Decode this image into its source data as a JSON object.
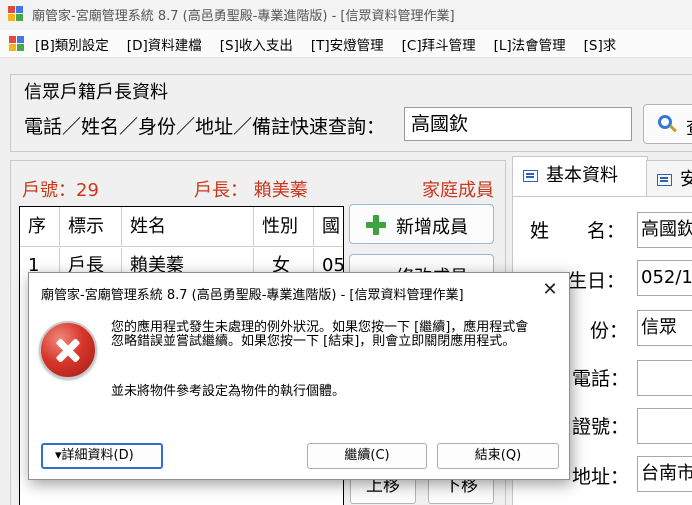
{
  "window": {
    "title": "廟管家-宮廟管理系統 8.7 (高邑勇聖殿-專業進階版) - [信眾資料管理作業]"
  },
  "menu": {
    "items": [
      "[B]類別設定",
      "[D]資料建檔",
      "[S]收入支出",
      "[T]安燈管理",
      "[C]拜斗管理",
      "[L]法會管理",
      "[S]求"
    ]
  },
  "search": {
    "title": "信眾戶籍戶長資料",
    "label": "電話／姓名／身份／地址／備註快速查詢：",
    "value": "高國欽",
    "button_label": "查"
  },
  "household": {
    "number": "戶號：29",
    "head": "戶長： 賴美蓁",
    "members_title": "家庭成員"
  },
  "members_table": {
    "headers": [
      "序",
      "標示",
      "姓名",
      "性別",
      "國"
    ],
    "rows": [
      [
        "1",
        "戶長",
        "賴美蓁",
        "女",
        "05"
      ]
    ]
  },
  "buttons": {
    "add_member": "新增成員",
    "edit_member": "修改成員",
    "move_up": "上移",
    "move_down": "下移"
  },
  "tabs": [
    {
      "label": "基本資料",
      "active": true
    },
    {
      "label": "安",
      "active": false
    }
  ],
  "form": {
    "name_label": "姓　　名：",
    "name_value": "高國欽",
    "birth_label": "國曆生日：",
    "birth_value": "052/10",
    "identity_label": "份：",
    "identity_value": "信眾",
    "phone_label": "電話：",
    "id_number_label": "證號：",
    "address_label": "地址：",
    "address_value": "台南市"
  },
  "dialog": {
    "title": "廟管家-宮廟管理系統 8.7 (高邑勇聖殿-專業進階版) - [信眾資料管理作業]",
    "message": "您的應用程式發生未處理的例外狀況。如果您按一下 [繼續]，應用程式會忽略錯誤並嘗試繼續。如果您按一下 [結束]，則會立即關閉應用程式。",
    "detail": "並未將物件參考設定為物件的執行個體。",
    "details_button": "▾詳細資料(D)",
    "continue_button": "繼續(C)",
    "quit_button": "結束(Q)",
    "close_glyph": "✕"
  }
}
